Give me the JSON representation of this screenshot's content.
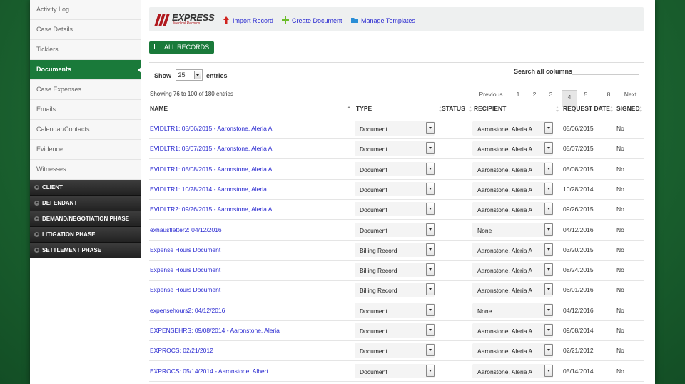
{
  "sidebar": {
    "items": [
      "Activity Log",
      "Case Details",
      "Ticklers",
      "Documents",
      "Case Expenses",
      "Emails",
      "Calendar/Contacts",
      "Evidence",
      "Witnesses"
    ],
    "active_index": 3,
    "phases": [
      "CLIENT",
      "DEFENDANT",
      "DEMAND/NEGOTIATION PHASE",
      "LITIGATION PHASE",
      "SETTLEMENT PHASE"
    ]
  },
  "toolbar": {
    "logo_text": "EXPRESS",
    "logo_sub": "Medical Records",
    "import_label": "Import Record",
    "create_label": "Create Document",
    "manage_label": "Manage Templates"
  },
  "all_records_label": "ALL RECORDS",
  "table_controls": {
    "show_label": "Show",
    "page_size": "25",
    "entries_label": "entries",
    "search_label": "Search all columns:",
    "search_value": "",
    "info": "Showing 76 to 100 of 180 entries"
  },
  "pagination": [
    "Previous",
    "1",
    "2",
    "3",
    "4",
    "5",
    "…",
    "8",
    "Next"
  ],
  "pagination_current": "4",
  "columns": [
    "NAME",
    "TYPE",
    "STATUS",
    "RECIPIENT",
    "REQUEST DATE",
    "SIGNED"
  ],
  "rows": [
    {
      "name": "EVIDLTR1: 05/06/2015 - Aaronstone, Aleria A.",
      "type": "Document",
      "status": "",
      "recipient": "Aaronstone, Aleria A",
      "date": "05/06/2015",
      "signed": "No"
    },
    {
      "name": "EVIDLTR1: 05/07/2015 - Aaronstone, Aleria A.",
      "type": "Document",
      "status": "",
      "recipient": "Aaronstone, Aleria A",
      "date": "05/07/2015",
      "signed": "No"
    },
    {
      "name": "EVIDLTR1: 05/08/2015 - Aaronstone, Aleria A.",
      "type": "Document",
      "status": "",
      "recipient": "Aaronstone, Aleria A",
      "date": "05/08/2015",
      "signed": "No"
    },
    {
      "name": "EVIDLTR1: 10/28/2014 - Aaronstone, Aleria",
      "type": "Document",
      "status": "",
      "recipient": "Aaronstone, Aleria A",
      "date": "10/28/2014",
      "signed": "No"
    },
    {
      "name": "EVIDLTR2: 09/26/2015 - Aaronstone, Aleria A.",
      "type": "Document",
      "status": "",
      "recipient": "Aaronstone, Aleria A",
      "date": "09/26/2015",
      "signed": "No"
    },
    {
      "name": "exhaustletter2: 04/12/2016",
      "type": "Document",
      "status": "",
      "recipient": "None",
      "date": "04/12/2016",
      "signed": "No"
    },
    {
      "name": "Expense Hours Document",
      "type": "Billing Record",
      "status": "",
      "recipient": "Aaronstone, Aleria A",
      "date": "03/20/2015",
      "signed": "No"
    },
    {
      "name": "Expense Hours Document",
      "type": "Billing Record",
      "status": "",
      "recipient": "Aaronstone, Aleria A",
      "date": "08/24/2015",
      "signed": "No"
    },
    {
      "name": "Expense Hours Document",
      "type": "Billing Record",
      "status": "",
      "recipient": "Aaronstone, Aleria A",
      "date": "06/01/2016",
      "signed": "No"
    },
    {
      "name": "expensehours2: 04/12/2016",
      "type": "Document",
      "status": "",
      "recipient": "None",
      "date": "04/12/2016",
      "signed": "No"
    },
    {
      "name": "EXPENSEHRS: 09/08/2014 - Aaronstone, Aleria",
      "type": "Document",
      "status": "",
      "recipient": "Aaronstone, Aleria A",
      "date": "09/08/2014",
      "signed": "No"
    },
    {
      "name": "EXPROCS: 02/21/2012",
      "type": "Document",
      "status": "",
      "recipient": "Aaronstone, Aleria A",
      "date": "02/21/2012",
      "signed": "No"
    },
    {
      "name": "EXPROCS: 05/14/2014 - Aaronstone, Albert",
      "type": "Document",
      "status": "",
      "recipient": "Aaronstone, Aleria A",
      "date": "05/14/2014",
      "signed": "No"
    }
  ]
}
